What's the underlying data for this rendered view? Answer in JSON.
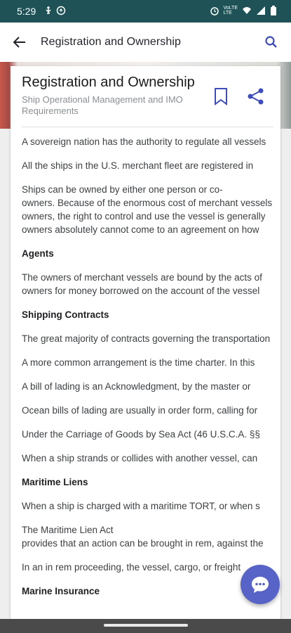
{
  "status_bar": {
    "time": "5:29",
    "left_icons": [
      "usb-icon",
      "sync-icon"
    ],
    "right_icons": [
      "alarm-icon",
      "volte-icon",
      "wifi-icon",
      "signal-icon",
      "battery-icon"
    ],
    "volte_text_top": "VoLTE",
    "volte_text_bottom": "LTE"
  },
  "app_bar": {
    "title": "Registration and Ownership",
    "back_icon": "arrow-back-icon",
    "search_icon": "search-icon"
  },
  "article": {
    "title": "Registration and Ownership",
    "subtitle": "Ship Operational Management and IMO Requirements",
    "bookmark_icon": "bookmark-icon",
    "share_icon": "share-icon",
    "blocks": [
      {
        "type": "para",
        "lines": [
          "A sovereign nation has the authority to regulate all vessels"
        ]
      },
      {
        "type": "para",
        "lines": [
          "All the ships in the U.S. merchant fleet are registered in"
        ]
      },
      {
        "type": "para",
        "lines": [
          "Ships can be owned by either one person or co-",
          "owners. Because of the enormous cost of merchant vessels",
          "owners, the right to control and use the vessel is generally",
          "owners absolutely cannot come to an agreement on how"
        ]
      },
      {
        "type": "heading",
        "text": "Agents"
      },
      {
        "type": "para",
        "lines": [
          "The owners of merchant vessels are bound by the acts of",
          "owners for money borrowed on the account of the vessel"
        ]
      },
      {
        "type": "heading",
        "text": "Shipping Contracts"
      },
      {
        "type": "para",
        "lines": [
          "The great majority of contracts governing the transportation"
        ]
      },
      {
        "type": "para",
        "lines": [
          "A more common arrangement is the time charter. In this"
        ]
      },
      {
        "type": "para",
        "lines": [
          "A bill of lading is an Acknowledgment, by the master or"
        ]
      },
      {
        "type": "para",
        "lines": [
          "Ocean bills of lading are usually in order form, calling for"
        ]
      },
      {
        "type": "para",
        "lines": [
          "Under the Carriage of Goods by Sea Act (46 U.S.C.A. §§"
        ]
      },
      {
        "type": "para",
        "lines": [
          "When a ship strands or collides with another vessel, can"
        ]
      },
      {
        "type": "heading",
        "text": "Maritime Liens"
      },
      {
        "type": "para",
        "lines": [
          "When a ship is charged with a maritime TORT, or when s"
        ]
      },
      {
        "type": "para",
        "lines": [
          "The Maritime Lien Act",
          "provides that an action can be brought in rem, against the"
        ]
      },
      {
        "type": "para",
        "lines": [
          "In an in rem proceeding, the vessel, cargo, or freight"
        ]
      },
      {
        "type": "heading",
        "text": "Marine Insurance"
      }
    ]
  },
  "fab": {
    "icon": "chat-icon",
    "color": "#5863c7"
  },
  "colors": {
    "status_bar": "#1f5256",
    "accent": "#3f4db8"
  }
}
